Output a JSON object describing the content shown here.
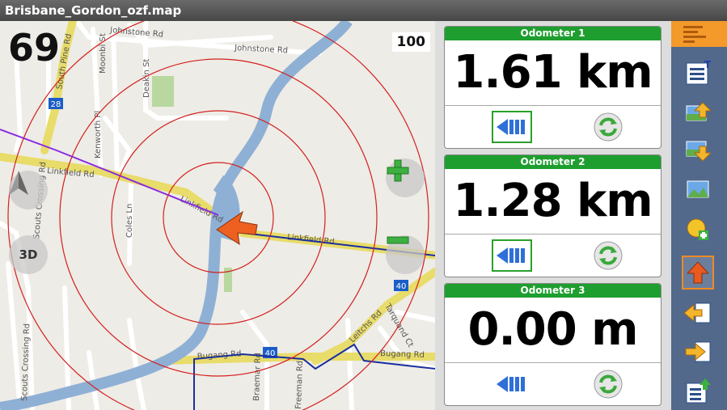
{
  "window": {
    "title": "Brisbane_Gordon_ozf.map"
  },
  "map": {
    "speed": "69",
    "zoom": "100",
    "btn_3d": "3D",
    "streets": [
      "Johnstone Rd",
      "Johnstone Rd",
      "South Pine Rd",
      "Moonbi St",
      "Deakin St",
      "Kenworth Pl",
      "Linkfield Rd",
      "Linkfield Rd",
      "Linkfield Rd",
      "Coles Ln",
      "Scouts Crossing Rd",
      "Scouts Crossing Rd",
      "Leitchs Rd",
      "Bugang Rd",
      "Bugang Rd",
      "Braemar Rd",
      "Tarquand Ct",
      "Freeman Rd"
    ],
    "route_shields": [
      "28",
      "40",
      "40"
    ]
  },
  "odometers": [
    {
      "title": "Odometer 1",
      "value": "1.61 km",
      "back_selected": true
    },
    {
      "title": "Odometer 2",
      "value": "1.28 km",
      "back_selected": true
    },
    {
      "title": "Odometer 3",
      "value": "0.00 m",
      "back_selected": false
    }
  ],
  "toolbar": {
    "icons": [
      "menu-icon",
      "track-list-icon",
      "upload-map-icon",
      "download-map-icon",
      "map-image-icon",
      "add-waypoint-icon",
      "navigate-up-icon",
      "track-back-icon",
      "track-forward-icon",
      "upload-list-icon"
    ],
    "selected": "navigate-up-icon"
  },
  "colors": {
    "odometer_header": "#1e9e2e",
    "toolbar": "#52698c",
    "range_rings": "#d22020",
    "track": "#1a2fa0",
    "route": "#8a2be2"
  }
}
